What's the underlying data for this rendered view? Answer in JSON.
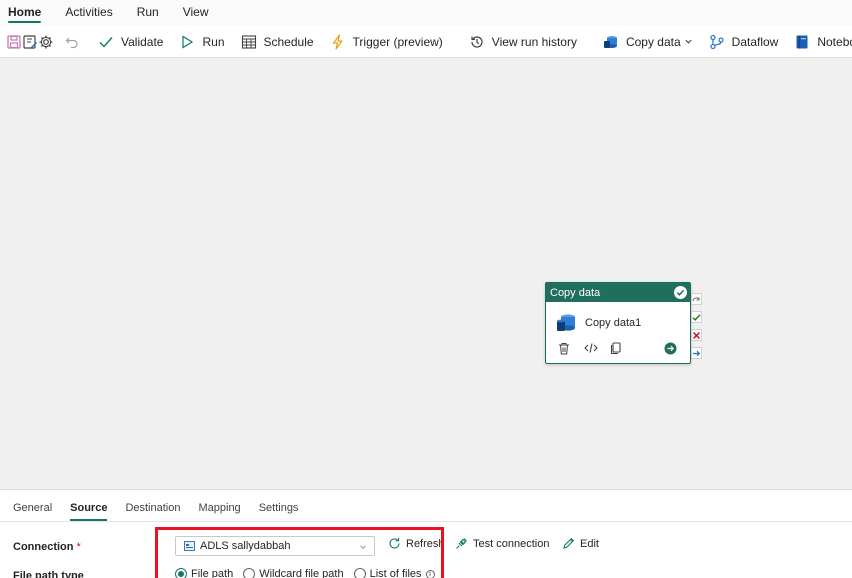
{
  "menu": {
    "tabs": [
      {
        "label": "Home",
        "active": true
      },
      {
        "label": "Activities"
      },
      {
        "label": "Run"
      },
      {
        "label": "View"
      }
    ]
  },
  "toolbar": {
    "validate": "Validate",
    "run": "Run",
    "schedule": "Schedule",
    "trigger": "Trigger (preview)",
    "view_run_history": "View run history",
    "copy_data": "Copy data",
    "dataflow": "Dataflow",
    "notebook": "Noteboo"
  },
  "node": {
    "type_label": "Copy data",
    "name": "Copy data1",
    "status": "succeeded"
  },
  "panel": {
    "tabs": [
      "General",
      "Source",
      "Destination",
      "Mapping",
      "Settings"
    ],
    "active_tab": "Source",
    "connection_label": "Connection",
    "required_mark": "*",
    "connection_value": "ADLS sallydabbah",
    "refresh": "Refresh",
    "test_connection": "Test connection",
    "edit": "Edit",
    "file_path_type_label": "File path type",
    "file_path_options": [
      "File path",
      "Wildcard file path",
      "List of files"
    ],
    "file_path_selected": "File path"
  },
  "colors": {
    "accent": "#117865",
    "node_header": "#1f6f5c",
    "highlight": "#e81123"
  }
}
